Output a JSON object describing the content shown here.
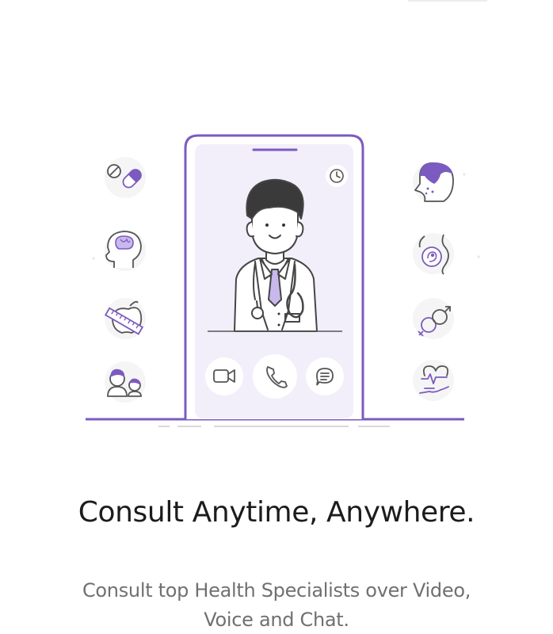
{
  "onboarding": {
    "title": "Consult Anytime, Anywhere.",
    "subtitle": "Consult top Health Specialists over Video, Voice and Chat."
  },
  "colors": {
    "accent": "#7b5bbf",
    "phone_fill": "#f2effb",
    "stroke": "#4a4a4a",
    "text_primary": "#1c1c1c",
    "text_secondary": "#707070"
  },
  "icons": {
    "left": [
      "pills-icon",
      "brain-icon",
      "apple-diet-icon",
      "parent-child-icon"
    ],
    "right": [
      "skin-face-icon",
      "pregnancy-icon",
      "gender-symbols-icon",
      "heartbeat-hand-icon"
    ],
    "call_actions": [
      "video-call-icon",
      "voice-call-icon",
      "chat-icon"
    ],
    "phone": [
      "clock-icon",
      "doctor-avatar"
    ]
  }
}
